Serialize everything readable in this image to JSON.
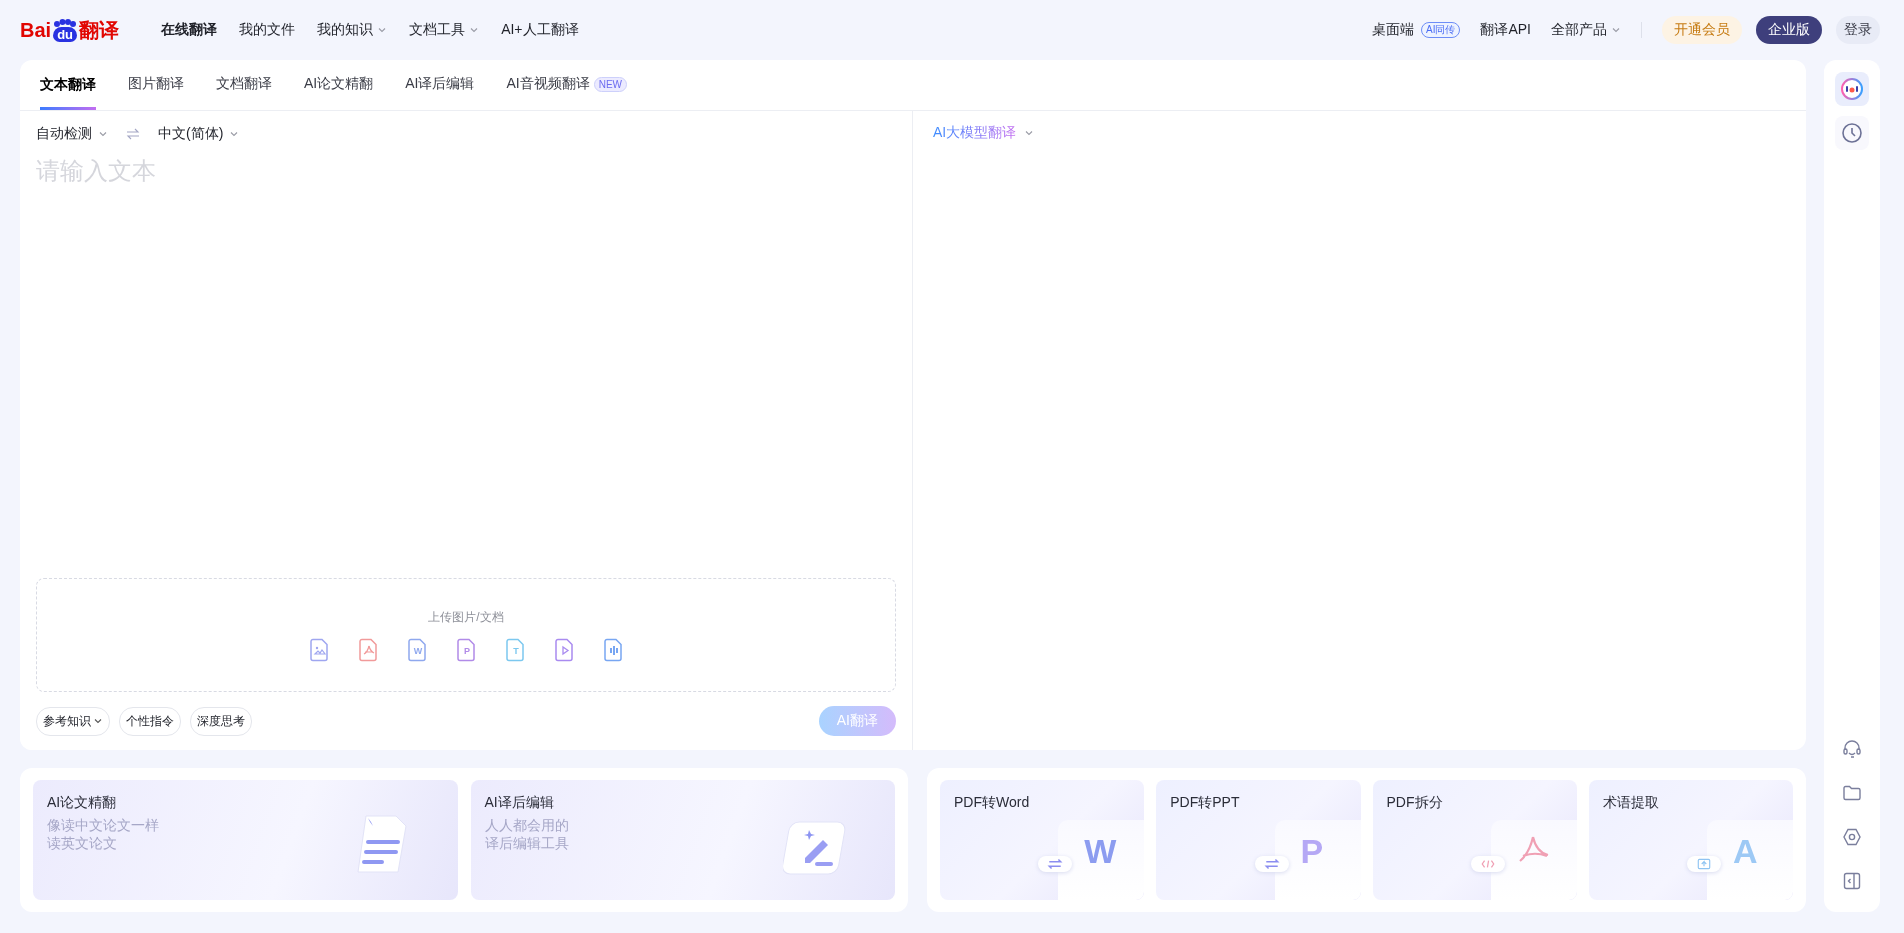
{
  "header": {
    "logo": {
      "latin": "Bai",
      "paw": "du",
      "name": "翻译"
    },
    "nav": [
      {
        "label": "在线翻译",
        "selected": true,
        "dropdown": false
      },
      {
        "label": "我的文件",
        "selected": false,
        "dropdown": false
      },
      {
        "label": "我的知识",
        "selected": false,
        "dropdown": true
      },
      {
        "label": "文档工具",
        "selected": false,
        "dropdown": true
      },
      {
        "label": "AI+人工翻译",
        "selected": false,
        "dropdown": false
      }
    ],
    "links": [
      {
        "label": "桌面端",
        "badge": "AI同传",
        "dropdown": false
      },
      {
        "label": "翻译API",
        "dropdown": false
      },
      {
        "label": "全部产品",
        "dropdown": true
      }
    ],
    "buttons": [
      {
        "label": "开通会员",
        "kind": "vip"
      },
      {
        "label": "企业版",
        "kind": "enterprise"
      },
      {
        "label": "登录",
        "kind": "login"
      }
    ]
  },
  "tabs": [
    {
      "label": "文本翻译",
      "selected": true
    },
    {
      "label": "图片翻译",
      "selected": false
    },
    {
      "label": "文档翻译",
      "selected": false
    },
    {
      "label": "AI论文精翻",
      "selected": false
    },
    {
      "label": "AI译后编辑",
      "selected": false
    },
    {
      "label": "AI音视频翻译",
      "selected": false,
      "badge": "NEW"
    }
  ],
  "source": {
    "from": "自动检测",
    "to": "中文(简体)",
    "placeholder": "请输入文本",
    "upload": {
      "label": "上传图片/文档",
      "formats": [
        {
          "kind": "image",
          "color": "#9fa6f0"
        },
        {
          "kind": "pdf",
          "color": "#f19a9a"
        },
        {
          "kind": "letter",
          "glyph": "W",
          "color": "#8fa8ee"
        },
        {
          "kind": "letter",
          "glyph": "P",
          "color": "#b18be8"
        },
        {
          "kind": "letter",
          "glyph": "T",
          "color": "#7cc8ef"
        },
        {
          "kind": "play",
          "color": "#a98bf0"
        },
        {
          "kind": "audio",
          "color": "#78a6f2"
        }
      ]
    },
    "chips": [
      {
        "label": "参考知识",
        "dropdown": true
      },
      {
        "label": "个性指令",
        "dropdown": false
      },
      {
        "label": "深度思考",
        "dropdown": false
      }
    ],
    "translate_button": {
      "label": "AI翻译",
      "disabled": true
    }
  },
  "target": {
    "model": "AI大模型翻译"
  },
  "features": [
    {
      "title": "AI论文精翻",
      "lines": [
        "像读中文论文一样",
        "读英文论文"
      ],
      "kind": "document"
    },
    {
      "title": "AI译后编辑",
      "lines": [
        "人人都会用的",
        "译后编辑工具"
      ],
      "kind": "pen"
    }
  ],
  "tools": [
    {
      "title": "PDF转Word",
      "kind": "letter",
      "glyph": "W",
      "pill": {
        "kind": "swap"
      },
      "color": "#8c9cf0"
    },
    {
      "title": "PDF转PPT",
      "kind": "letter",
      "glyph": "P",
      "pill": {
        "kind": "swap"
      },
      "color": "#b5a8f5"
    },
    {
      "title": "PDF拆分",
      "kind": "pdf",
      "pill": {
        "kind": "code"
      },
      "color": "#f0a0b4"
    },
    {
      "title": "术语提取",
      "kind": "letter",
      "glyph": "A",
      "pill": {
        "kind": "upload"
      },
      "color": "#9dc9f5"
    }
  ]
}
